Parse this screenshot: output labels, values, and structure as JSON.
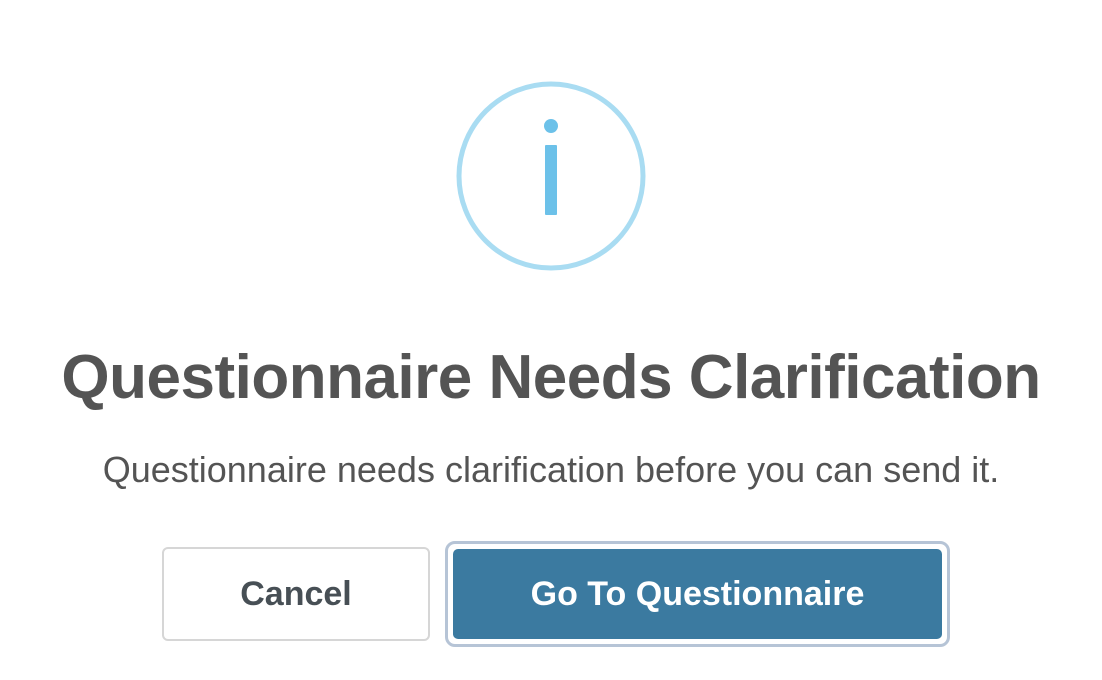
{
  "dialog": {
    "icon": "info-icon",
    "title": "Questionnaire Needs Clarification",
    "message": "Questionnaire needs clarification before you can send it.",
    "cancel_label": "Cancel",
    "confirm_label": "Go To Questionnaire"
  },
  "colors": {
    "icon_ring": "#a9dcf2",
    "icon_glyph": "#6cc1e9",
    "text": "#545454",
    "primary": "#3b7aa0",
    "primary_focus_ring": "#b6c4d6",
    "cancel_border": "#d6d6d6"
  }
}
